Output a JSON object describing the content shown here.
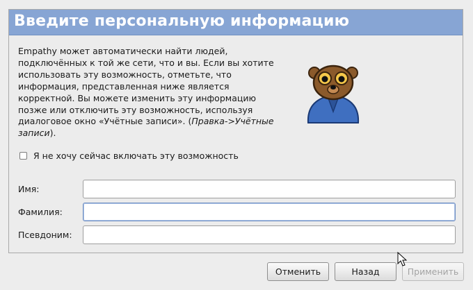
{
  "header": {
    "title": "Введите персональную информацию"
  },
  "intro": {
    "lines": [
      "Empathy может автоматически найти людей,",
      "подключённых к той же сети, что и вы. Если вы хотите",
      "использовать эту возможность, отметьте, что",
      "информация, представленная ниже является",
      "корректной. Вы можете изменить эту информацию",
      "позже или отключить эту возможность, используя",
      "диалоговое окно «Учётные записи». ("
    ],
    "italic_part_1": "Правка->Учётные",
    "italic_part_2": "записи",
    "tail": ")."
  },
  "checkbox": {
    "label": "Я не хочу сейчас включать эту возможность",
    "checked": false
  },
  "fields": {
    "first_name": {
      "label": "Имя:",
      "value": ""
    },
    "last_name": {
      "label": "Фамилия:",
      "value": ""
    },
    "nickname": {
      "label": "Псевдоним:",
      "value": ""
    }
  },
  "buttons": {
    "cancel": "Отменить",
    "back": "Назад",
    "apply": "Применить"
  },
  "colors": {
    "header_bg": "#87a5d4",
    "mascot_body": "#3f6fc0",
    "mascot_head": "#8b5a2b"
  },
  "icons": {
    "mascot": "empathy-mascot-icon",
    "pointer": "mouse-pointer-icon"
  }
}
